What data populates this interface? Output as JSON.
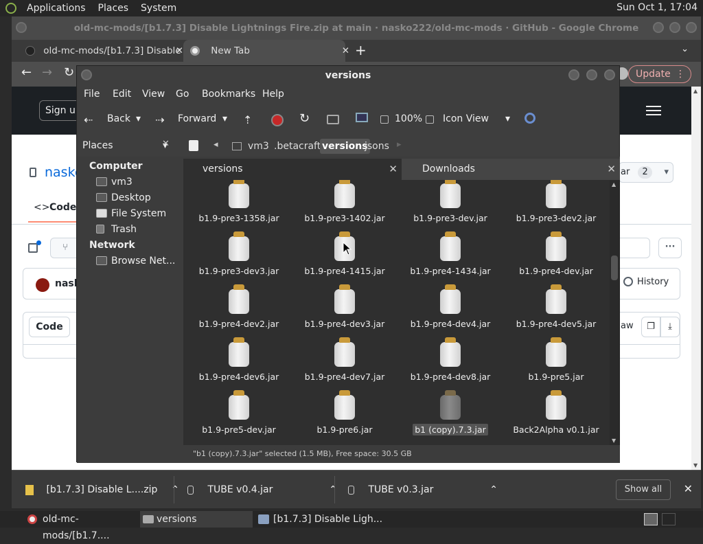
{
  "top_panel": {
    "menu": [
      "Applications",
      "Places",
      "System"
    ],
    "clock": "Sun Oct  1, 17:04"
  },
  "chrome": {
    "window_title": "old-mc-mods/[b1.7.3] Disable Lightnings Fire.zip at main · nasko222/old-mc-mods · GitHub - Google Chrome",
    "tabs": [
      {
        "label": "old-mc-mods/[b1.7.3] Disable"
      },
      {
        "label": "New Tab"
      }
    ],
    "update_label": "Update",
    "sign_up_label": "Sign up",
    "repo_owner": "nasko",
    "code_tab_label": "Code",
    "star_count": "2",
    "star_partial": "ar",
    "author_partial": "nask",
    "history_label": "History",
    "code_button_label": "Code",
    "raw_partial": "aw"
  },
  "file_manager": {
    "title": "versions",
    "menu": [
      "File",
      "Edit",
      "View",
      "Go",
      "Bookmarks",
      "Help"
    ],
    "toolbar": {
      "back": "Back",
      "forward": "Forward",
      "zoom": "100%",
      "view_mode": "Icon View"
    },
    "places_label": "Places",
    "breadcrumbs": [
      "vm3",
      ".betacraft",
      "versions",
      "jsons"
    ],
    "sidebar": {
      "computer_header": "Computer",
      "computer_items": [
        "vm3",
        "Desktop",
        "File System",
        "Trash"
      ],
      "network_header": "Network",
      "network_items": [
        "Browse Net..."
      ]
    },
    "tabs": [
      "versions",
      "Downloads"
    ],
    "files": [
      "b1.9-pre3-1358.jar",
      "b1.9-pre3-1402.jar",
      "b1.9-pre3-dev.jar",
      "b1.9-pre3-dev2.jar",
      "b1.9-pre3-dev3.jar",
      "b1.9-pre4-1415.jar",
      "b1.9-pre4-1434.jar",
      "b1.9-pre4-dev.jar",
      "b1.9-pre4-dev2.jar",
      "b1.9-pre4-dev3.jar",
      "b1.9-pre4-dev4.jar",
      "b1.9-pre4-dev5.jar",
      "b1.9-pre4-dev6.jar",
      "b1.9-pre4-dev7.jar",
      "b1.9-pre4-dev8.jar",
      "b1.9-pre5.jar",
      "b1.9-pre5-dev.jar",
      "b1.9-pre6.jar",
      "b1 (copy).7.3.jar",
      "Back2Alpha v0.1.jar"
    ],
    "selected_file": "b1 (copy).7.3.jar",
    "status": "\"b1 (copy).7.3.jar\" selected (1.5 MB), Free space: 30.5 GB"
  },
  "downloads": {
    "items": [
      "[b1.7.3] Disable L....zip",
      "TUBE v0.4.jar",
      "TUBE v0.3.jar"
    ],
    "show_all": "Show all"
  },
  "taskbar": {
    "items": [
      "old-mc-mods/[b1.7....",
      "versions",
      "[b1.7.3] Disable Ligh..."
    ]
  }
}
